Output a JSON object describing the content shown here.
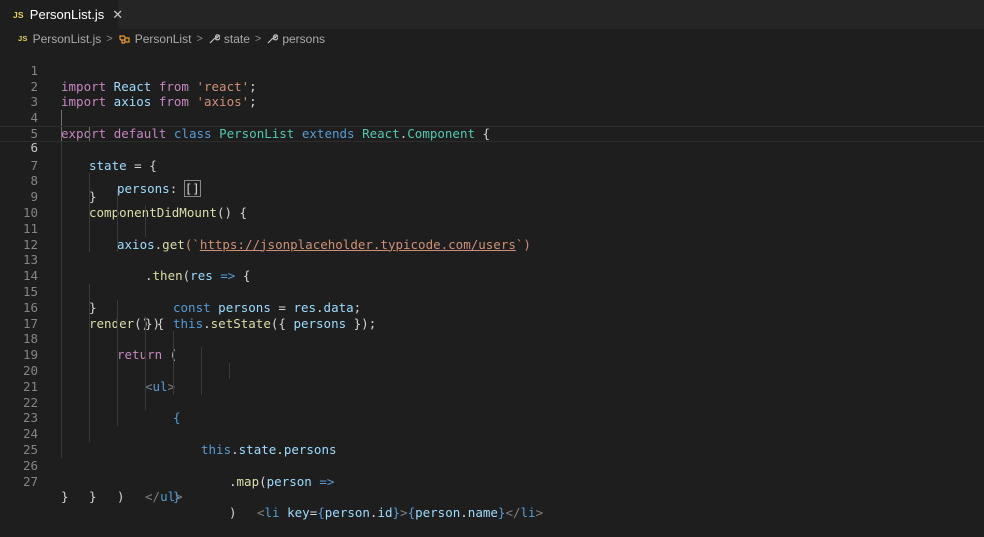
{
  "tab": {
    "label": "PersonList.js",
    "icon": "js-file-icon",
    "close_icon": "close-icon",
    "close_glyph": "✕",
    "badge": "JS"
  },
  "breadcrumb": {
    "file": "PersonList.js",
    "items": [
      {
        "label": "PersonList",
        "icon": "class-icon"
      },
      {
        "label": "state",
        "icon": "wrench-icon"
      },
      {
        "label": "persons",
        "icon": "wrench-icon"
      }
    ],
    "separator": ">"
  },
  "editor": {
    "current_line": 6,
    "colors": {
      "background": "#1e1e1e",
      "keyword": "#c586c0",
      "storage": "#569cd6",
      "variable": "#9cdcfe",
      "type": "#4ec9b0",
      "function": "#dcdcaa",
      "string": "#ce9178"
    },
    "lines": [
      {
        "n": "1"
      },
      {
        "n": "2"
      },
      {
        "n": "3"
      },
      {
        "n": "4"
      },
      {
        "n": "5"
      },
      {
        "n": "6"
      },
      {
        "n": "7"
      },
      {
        "n": "8"
      },
      {
        "n": "9"
      },
      {
        "n": "10"
      },
      {
        "n": "11"
      },
      {
        "n": "12"
      },
      {
        "n": "13"
      },
      {
        "n": "14"
      },
      {
        "n": "15"
      },
      {
        "n": "16"
      },
      {
        "n": "17"
      },
      {
        "n": "18"
      },
      {
        "n": "19"
      },
      {
        "n": "20"
      },
      {
        "n": "21"
      },
      {
        "n": "22"
      },
      {
        "n": "23"
      },
      {
        "n": "24"
      },
      {
        "n": "25"
      },
      {
        "n": "26"
      },
      {
        "n": "27"
      }
    ],
    "code": {
      "l1": [
        "import",
        " React ",
        "from",
        " 'react'",
        ";"
      ],
      "l2": [
        "import",
        " axios ",
        "from",
        " 'axios'",
        ";"
      ],
      "l4": [
        "export",
        " ",
        "default",
        " ",
        "class",
        " ",
        "PersonList",
        " ",
        "extends",
        " ",
        "React",
        ".",
        "Component",
        " {"
      ],
      "l5": [
        "state",
        " = {"
      ],
      "l6": [
        "persons",
        ": ",
        "[]"
      ],
      "l7": [
        "}"
      ],
      "l8": [
        "componentDidMount",
        "() {"
      ],
      "l9": [
        "axios",
        ".",
        "get",
        "(`",
        "https://jsonplaceholder.typicode.com/users",
        "`)"
      ],
      "l10": [
        ".",
        "then",
        "(",
        "res",
        " ",
        "=>",
        " {"
      ],
      "l11": [
        "const",
        " ",
        "persons",
        " = ",
        "res",
        ".",
        "data",
        ";"
      ],
      "l12": [
        "this",
        ".",
        "setState",
        "({ ",
        "persons",
        " });"
      ],
      "l13": [
        "})"
      ],
      "l14": [
        "}"
      ],
      "l15": [
        "render",
        "() {"
      ],
      "l16": [
        "return",
        " ("
      ],
      "l17": [
        "<",
        "ul",
        ">"
      ],
      "l18": [
        "{"
      ],
      "l19": [
        "this",
        ".",
        "state",
        ".",
        "persons"
      ],
      "l20": [
        ".",
        "map",
        "(",
        "person",
        " ",
        "=>"
      ],
      "l21": [
        "<",
        "li",
        " ",
        "key",
        "=",
        "{",
        "person",
        ".",
        "id",
        "}",
        ">",
        "{",
        "person",
        ".",
        "name",
        "}",
        "</",
        "li",
        ">"
      ],
      "l22": [
        ")"
      ],
      "l23": [
        "}"
      ],
      "l24": [
        "</",
        "ul",
        ">"
      ],
      "l25": [
        ")"
      ],
      "l26": [
        "}"
      ],
      "l27": [
        "}"
      ]
    }
  }
}
